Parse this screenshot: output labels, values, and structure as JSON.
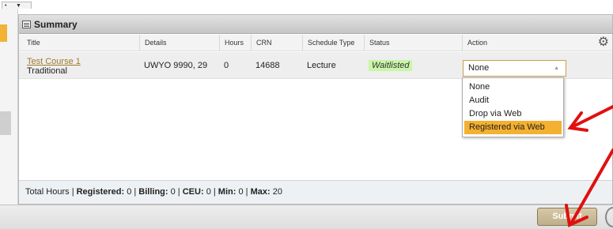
{
  "top": {
    "dot": "•",
    "caret": "▼"
  },
  "panel": {
    "title": "Summary"
  },
  "table": {
    "columns": [
      "Title",
      "Details",
      "Hours",
      "CRN",
      "Schedule Type",
      "Status",
      "Action"
    ],
    "rows": [
      {
        "title": "Test Course 1",
        "subtitle": "Traditional",
        "details": "UWYO 9990, 29",
        "hours": "0",
        "crn": "14688",
        "schedule_type": "Lecture",
        "status": "Waitlisted",
        "action_selected": "None"
      }
    ]
  },
  "dropdown": {
    "options": [
      "None",
      "Audit",
      "Drop via Web",
      "Registered via Web"
    ],
    "highlighted": "Registered via Web"
  },
  "footer": {
    "prefix": "Total Hours | ",
    "registered_label": "Registered: ",
    "registered": "0",
    "sep1": " | ",
    "billing_label": "Billing: ",
    "billing": "0",
    "sep2": " | ",
    "ceu_label": "CEU: ",
    "ceu": "0",
    "sep3": " | ",
    "min_label": "Min: ",
    "min": "0",
    "sep4": " | ",
    "max_label": "Max: ",
    "max": "20"
  },
  "submit_label": "Submit",
  "colors": {
    "accent": "#f4b030",
    "status_bg": "#c9f5a8",
    "link": "#a07a2c",
    "annotation_arrow": "#e01010"
  },
  "icons": {
    "summary": "table-icon",
    "settings": "gear-icon",
    "select_caret": "chevron-up-icon"
  }
}
